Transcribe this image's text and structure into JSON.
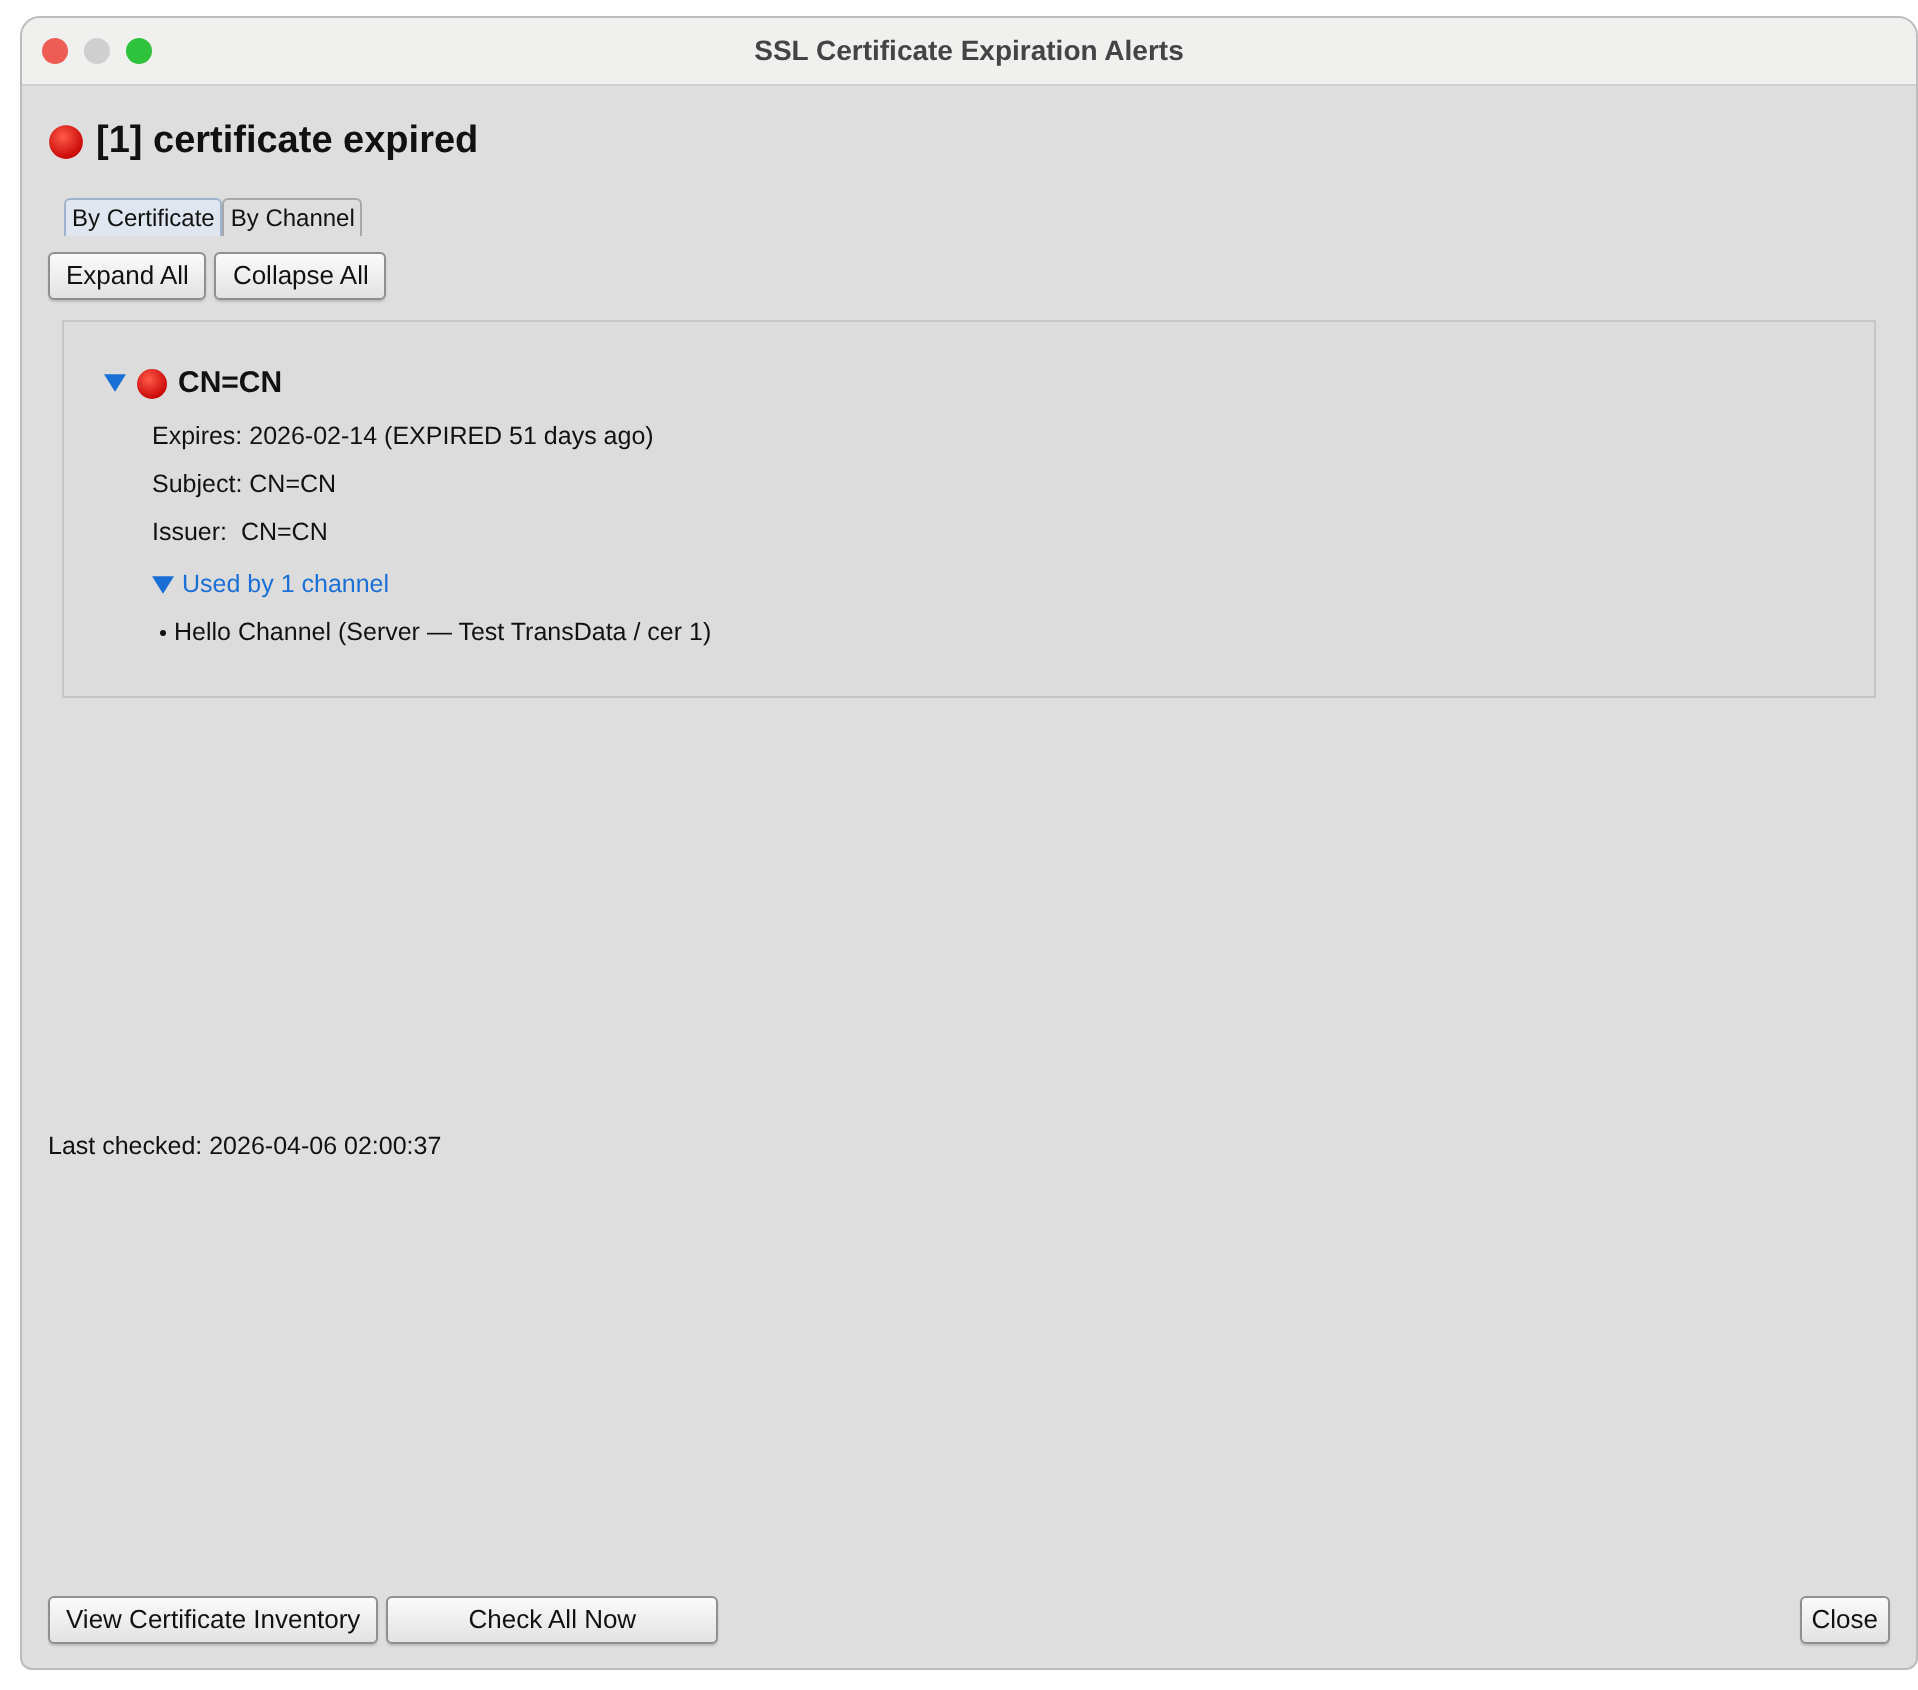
{
  "window": {
    "title": "SSL Certificate Expiration Alerts"
  },
  "heading": "[1] certificate expired",
  "tabs": [
    {
      "label": "By Certificate",
      "selected": true
    },
    {
      "label": "By Channel",
      "selected": false
    }
  ],
  "toolbar": [
    "Expand All",
    "Collapse All"
  ],
  "certificates": [
    {
      "name": "CN=CN",
      "expanded": true,
      "details": [
        "Expires: 2026-02-14 (EXPIRED 51 days ago)",
        "Subject: CN=CN",
        "Issuer:  CN=CN"
      ],
      "channels_toggle": {
        "label": "Used by 1 channel",
        "expanded": true
      },
      "channels": [
        "Hello Channel (Server — Test TransData / cer 1)"
      ]
    }
  ],
  "last_checked": "Last checked: 2026-04-06 02:00:37",
  "footer_buttons": [
    "View Certificate Inventory",
    "Check All Now"
  ],
  "close_button": "Close"
}
